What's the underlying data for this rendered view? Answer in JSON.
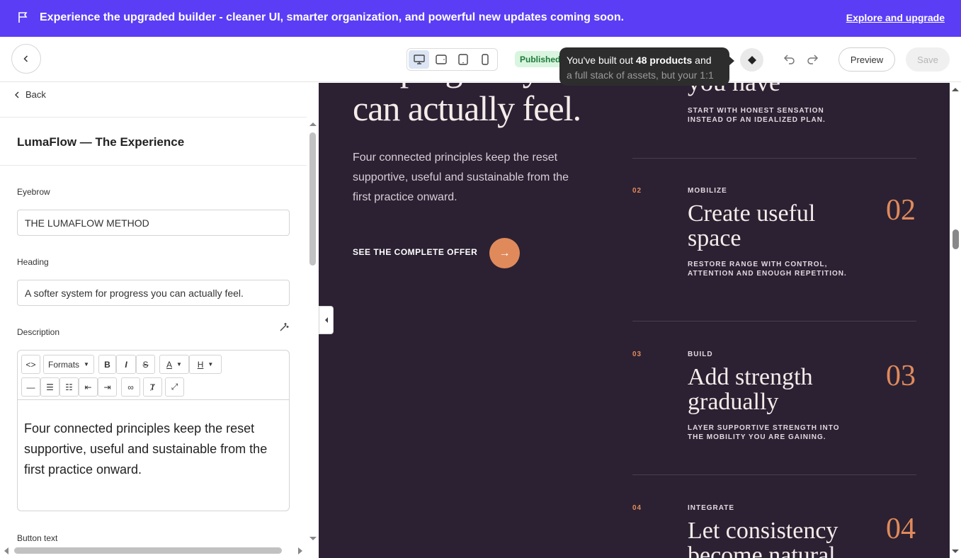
{
  "banner": {
    "message": "Experience the upgraded builder - cleaner UI, smarter organization, and powerful new updates coming soon.",
    "link": "Explore and upgrade"
  },
  "topbar": {
    "status": "Published",
    "tooltip_pre": "You've built out ",
    "tooltip_bold": "48 products",
    "tooltip_post": " and",
    "tooltip_line2": "a full stack of assets, but your 1:1",
    "preview": "Preview",
    "save": "Save"
  },
  "panel": {
    "back": "Back",
    "title": "LumaFlow — The Experience",
    "eyebrow_label": "Eyebrow",
    "eyebrow_value": "THE LUMAFLOW METHOD",
    "heading_label": "Heading",
    "heading_value": "A softer system for progress you can actually feel.",
    "description_label": "Description",
    "formats": "Formats",
    "description_value": "Four connected principles keep the reset supportive, useful and sustainable from the first practice onward.",
    "button_text_label": "Button text"
  },
  "preview": {
    "heading_line1": "for progress you",
    "heading_line2": "can actually feel.",
    "description": "Four connected principles keep the reset supportive, useful and sustainable from the first practice onward.",
    "cta": "SEE THE COMPLETE OFFER",
    "cta_arrow": "→",
    "step1_heading": "you have",
    "step1_sub": "START WITH HONEST SENSATION INSTEAD OF AN IDEALIZED PLAN.",
    "steps": [
      {
        "num": "02",
        "kicker": "MOBILIZE",
        "heading": "Create useful space",
        "sub": "RESTORE RANGE WITH CONTROL, ATTENTION AND ENOUGH REPETITION.",
        "big": "02"
      },
      {
        "num": "03",
        "kicker": "BUILD",
        "heading": "Add strength gradually",
        "sub": "LAYER SUPPORTIVE STRENGTH INTO THE MOBILITY YOU ARE GAINING.",
        "big": "03"
      },
      {
        "num": "04",
        "kicker": "INTEGRATE",
        "heading": "Let consistency become natural",
        "sub": "",
        "big": "04"
      }
    ]
  },
  "colors": {
    "banner": "#5b3df5",
    "canvas": "#2b2132",
    "accent": "#e08a5c"
  },
  "icons": [
    "flag-icon",
    "chevron-left-icon",
    "desktop-icon",
    "tablet-landscape-icon",
    "tablet-icon",
    "mobile-icon",
    "diamond-icon",
    "undo-icon",
    "redo-icon",
    "magic-wand-icon",
    "code-icon",
    "bold-icon",
    "italic-icon",
    "strikethrough-icon",
    "text-color-icon",
    "highlight-icon",
    "horizontal-rule-icon",
    "bullet-list-icon",
    "numbered-list-icon",
    "outdent-icon",
    "indent-icon",
    "link-icon",
    "clear-format-icon",
    "fullscreen-icon"
  ]
}
